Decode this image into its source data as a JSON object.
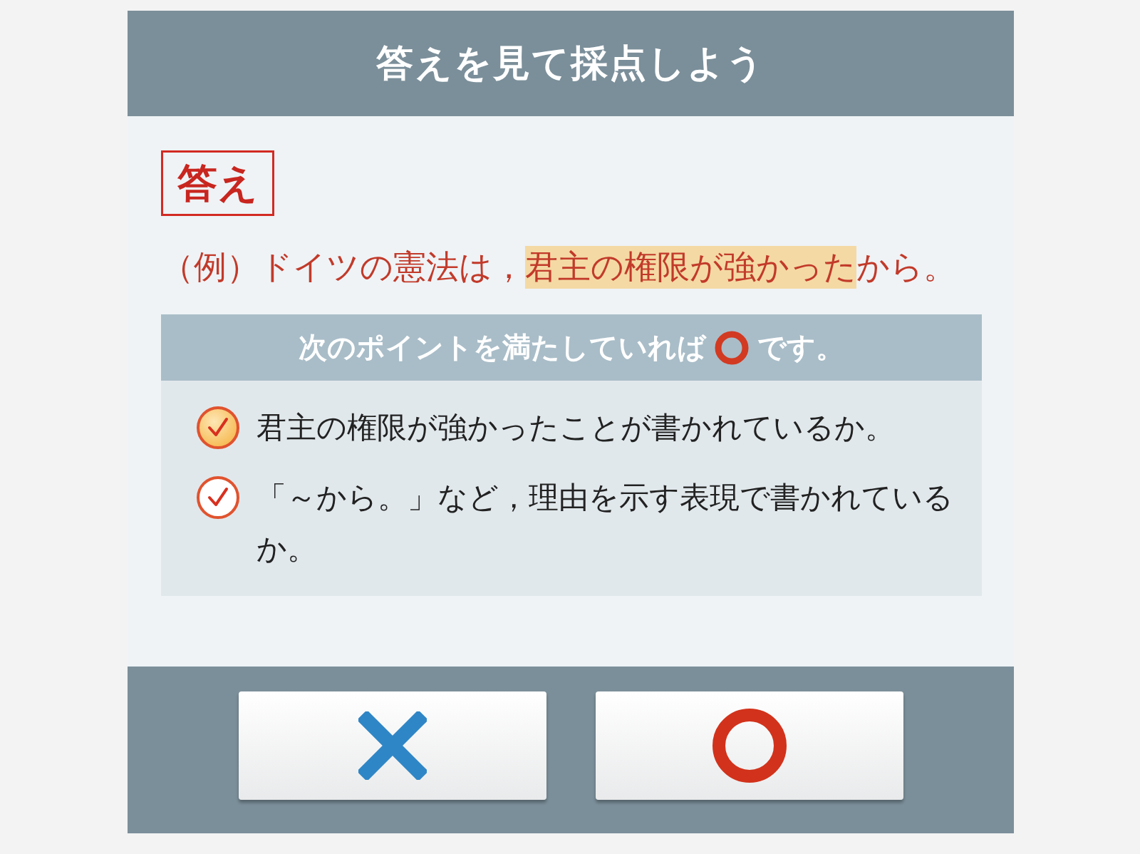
{
  "header": {
    "title": "答えを見て採点しよう"
  },
  "answer": {
    "label": "答え",
    "segments": [
      {
        "text": "（例）ドイツの憲法は，",
        "highlighted": false
      },
      {
        "text": "君主の権限が強かった",
        "highlighted": true
      },
      {
        "text": "から。",
        "highlighted": false
      }
    ]
  },
  "points": {
    "heading_before": "次のポイントを満たしていれば",
    "heading_after": "です。",
    "items": [
      {
        "text": "君主の権限が強かったことが書かれているか。",
        "checked": true
      },
      {
        "text": "「～から。」など，理由を示す表現で書かれているか。",
        "checked": false
      }
    ]
  },
  "buttons": [
    {
      "kind": "wrong"
    },
    {
      "kind": "correct"
    }
  ]
}
